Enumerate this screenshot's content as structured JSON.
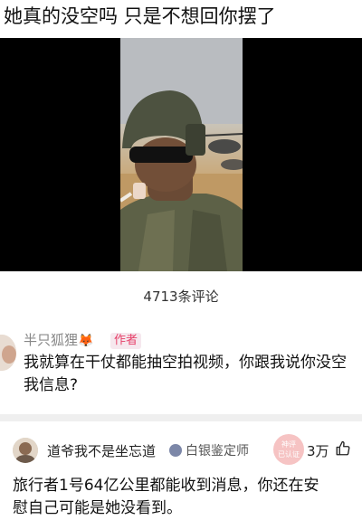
{
  "post": {
    "title": "她真的没空吗 只是不想回你摆了"
  },
  "comments_header": {
    "count": "4713条评论"
  },
  "comment1": {
    "author": "半只狐狸",
    "author_emoji": "🦊",
    "badge": "作者",
    "text_line1": "我就算在干仗都能抽空拍视频，你跟我说你没空",
    "text_line2": "我信息?"
  },
  "comment2": {
    "author": "道爷我不是坐忘道",
    "level_badge": "白银鉴定师",
    "stamp_top": "神评",
    "stamp_bottom": "已认证",
    "likes": "3万",
    "text_line1": "旅行者1号64亿公里都能收到消息，你还在安",
    "text_line2": "慰自己可能是她没看到。"
  },
  "colors": {
    "badge_text": "#e64069",
    "badge_bg": "#f6e8ee",
    "divider": "#efefef"
  },
  "icons": {
    "like": "thumbs-up-icon",
    "level": "silver-medal-icon"
  }
}
